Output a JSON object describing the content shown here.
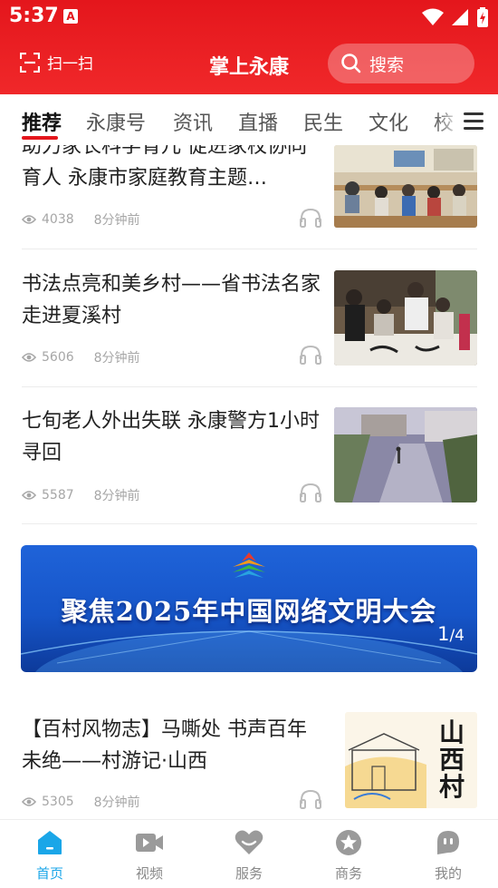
{
  "status_bar": {
    "time": "5:37",
    "notification_glyph": "A"
  },
  "header": {
    "scan_label": "扫一扫",
    "title": "掌上永康",
    "search_label": "搜索"
  },
  "tabs": [
    "推荐",
    "永康号",
    "资讯",
    "直播",
    "民生",
    "文化",
    "校"
  ],
  "articles": [
    {
      "title": "助力家长科学育儿 促进家校协同育人 永康市家庭教育主题…",
      "views": "4038",
      "time": "8分钟前"
    },
    {
      "title": "书法点亮和美乡村——省书法名家走进夏溪村",
      "views": "5606",
      "time": "8分钟前"
    },
    {
      "title": "七旬老人外出失联 永康警方1小时寻回",
      "views": "5587",
      "time": "8分钟前"
    },
    {
      "title": "【百村风物志】马嘶处 书声百年未绝——村游记·山西",
      "views": "5305",
      "time": "8分钟前"
    }
  ],
  "banner": {
    "text": "聚焦2025年中国网络文明大会",
    "index": "1",
    "total": "/4"
  },
  "thumb_art_text": "山西村",
  "bottom_nav": [
    {
      "label": "首页",
      "icon": "home-icon",
      "active": true
    },
    {
      "label": "视频",
      "icon": "video-icon",
      "active": false
    },
    {
      "label": "服务",
      "icon": "heart-icon",
      "active": false
    },
    {
      "label": "商务",
      "icon": "star-icon",
      "active": false
    },
    {
      "label": "我的",
      "icon": "profile-icon",
      "active": false
    }
  ],
  "colors": {
    "brand_red": "#e4161c",
    "active_blue": "#1aa6e8",
    "meta_gray": "#a6a6a6"
  }
}
